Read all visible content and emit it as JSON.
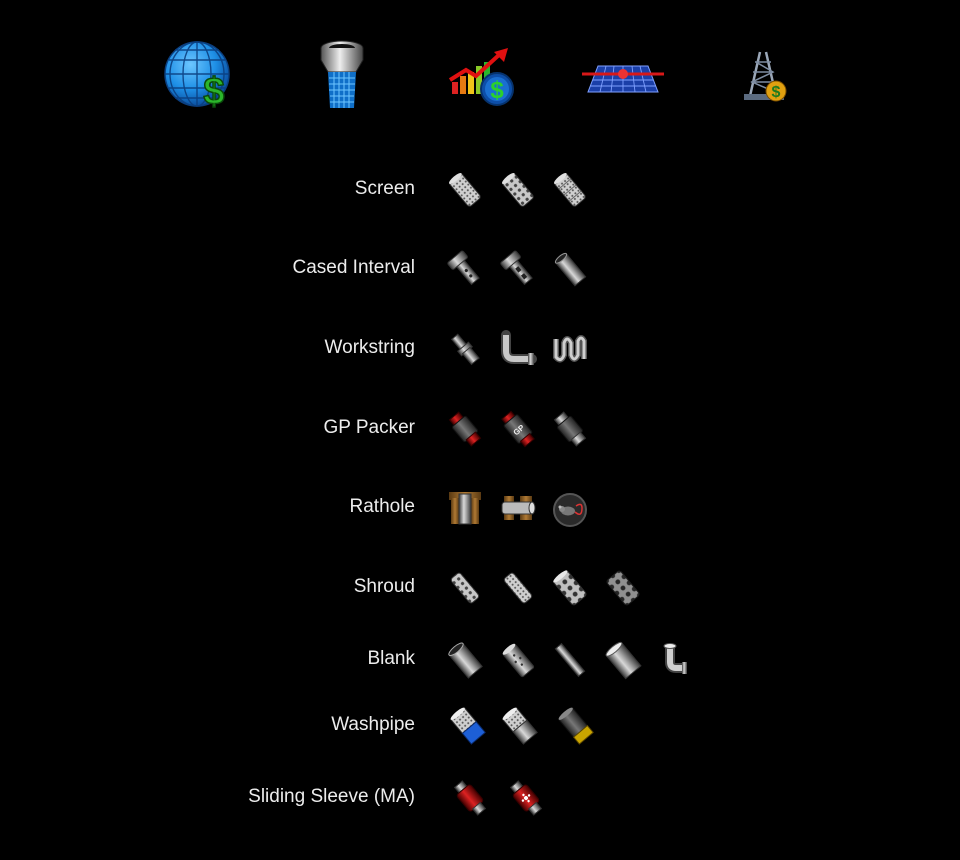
{
  "top_icons": [
    {
      "name": "globe-dollar-icon"
    },
    {
      "name": "filter-screen-icon"
    },
    {
      "name": "growth-chart-dollar-icon"
    },
    {
      "name": "flow-plane-icon"
    },
    {
      "name": "derrick-dollar-icon"
    }
  ],
  "rows": [
    {
      "label": "Screen",
      "icons": [
        "screen-pattern-1-icon",
        "screen-pattern-2-icon",
        "screen-pattern-3-icon"
      ]
    },
    {
      "label": "Cased Interval",
      "icons": [
        "cased-interval-perforated-icon",
        "cased-interval-slotted-icon",
        "cased-interval-plain-icon"
      ]
    },
    {
      "label": "Workstring",
      "icons": [
        "workstring-straight-icon",
        "workstring-elbow-icon",
        "workstring-coiled-icon"
      ]
    },
    {
      "label": "GP Packer",
      "icons": [
        "gp-packer-red-icon",
        "gp-packer-labeled-icon",
        "gp-packer-gray-icon"
      ]
    },
    {
      "label": "Rathole",
      "icons": [
        "rathole-vertical-icon",
        "rathole-horizontal-icon",
        "rathole-rat-icon"
      ]
    },
    {
      "label": "Shroud",
      "icons": [
        "shroud-small-holes-icon",
        "shroud-fine-holes-icon",
        "shroud-large-holes-icon",
        "shroud-dark-holes-icon"
      ]
    },
    {
      "label": "Blank",
      "icons": [
        "blank-open-end-icon",
        "blank-dotted-icon",
        "blank-thin-icon",
        "blank-wide-icon",
        "blank-elbow-icon"
      ]
    },
    {
      "label": "Washpipe",
      "icons": [
        "washpipe-blue-icon",
        "washpipe-silver-icon",
        "washpipe-yellow-icon"
      ]
    },
    {
      "label": "Sliding Sleeve (MA)",
      "icons": [
        "sliding-sleeve-closed-icon",
        "sliding-sleeve-open-icon"
      ]
    }
  ],
  "gp_packer_badge": "GP",
  "colors": {
    "background": "#000000",
    "text": "#ececec",
    "steel": "#9a9a9a",
    "money_green": "#2bb52b",
    "globe_blue": "#1e8fe6",
    "packer_red": "#a01010",
    "washpipe_blue": "#1d5fd6",
    "washpipe_yellow": "#c9a400"
  }
}
